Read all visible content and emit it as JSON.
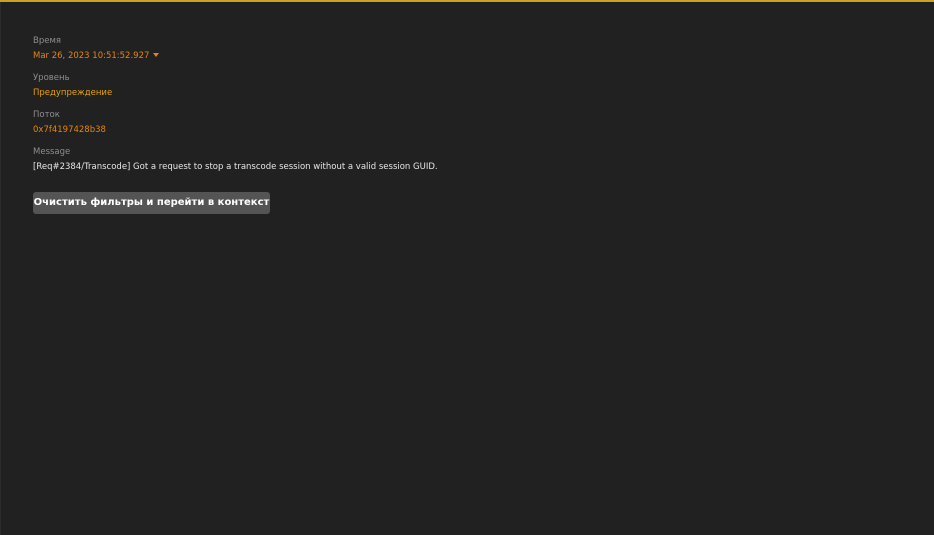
{
  "log_entry": {
    "time": {
      "label": "Время",
      "value": "Mar 26, 2023 10:51:52.927"
    },
    "level": {
      "label": "Уровень",
      "value": "Предупреждение"
    },
    "thread": {
      "label": "Поток",
      "value": "0x7f4197428b38"
    },
    "message": {
      "label": "Message",
      "value": "[Req#2384/Transcode] Got a request to stop a transcode session without a valid session GUID."
    }
  },
  "actions": {
    "clear_filters_label": "Очистить фильтры и перейти в контекст"
  },
  "colors": {
    "accent_orange": "#e5850e",
    "accent_gold": "#e5a00d",
    "background": "#212121",
    "button": "#545454"
  },
  "icons": {
    "time_dropdown": "caret-down-icon"
  }
}
